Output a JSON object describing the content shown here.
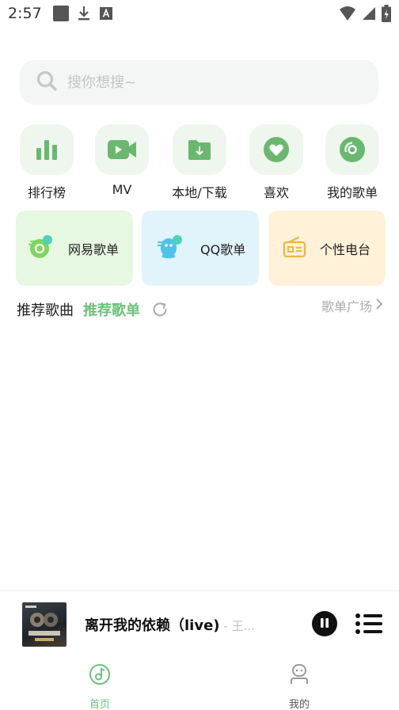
{
  "status_bar": {
    "time": "2:57"
  },
  "search": {
    "placeholder": "搜你想搜~"
  },
  "quick_nav": {
    "items": [
      {
        "label": "排行榜",
        "icon": "bar-chart-icon"
      },
      {
        "label": "MV",
        "icon": "video-icon"
      },
      {
        "label": "本地/下载",
        "icon": "folder-download-icon"
      },
      {
        "label": "喜欢",
        "icon": "heart-icon"
      },
      {
        "label": "我的歌单",
        "icon": "disc-icon"
      }
    ]
  },
  "cards": [
    {
      "label": "网易歌单",
      "icon": "netease-music-icon",
      "color": "#e6f7e2"
    },
    {
      "label": "QQ歌单",
      "icon": "qq-icon",
      "color": "#e1f3fb"
    },
    {
      "label": "个性电台",
      "icon": "radio-icon",
      "color": "#fff2d9"
    }
  ],
  "tabs": {
    "items": [
      {
        "label": "推荐歌曲",
        "active": false
      },
      {
        "label": "推荐歌单",
        "active": true
      }
    ],
    "plaza_label": "歌单广场"
  },
  "player": {
    "title": "离开我的依赖（live)",
    "artist": " - 王..."
  },
  "bottom_nav": {
    "items": [
      {
        "label": "首页",
        "active": true
      },
      {
        "label": "我的",
        "active": false
      }
    ]
  },
  "colors": {
    "accent": "#6cc17a",
    "icon_green": "#6ab86f",
    "muted": "#aaaaaa"
  }
}
